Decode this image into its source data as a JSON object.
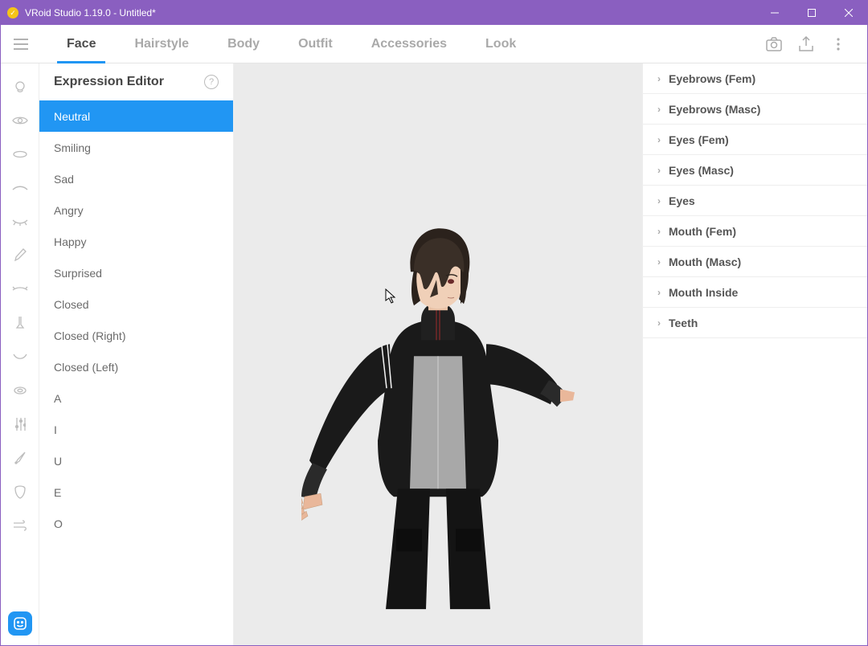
{
  "titlebar": {
    "title": "VRoid Studio 1.19.0 - Untitled*"
  },
  "tabs": {
    "items": [
      {
        "label": "Face",
        "active": true
      },
      {
        "label": "Hairstyle",
        "active": false
      },
      {
        "label": "Body",
        "active": false
      },
      {
        "label": "Outfit",
        "active": false
      },
      {
        "label": "Accessories",
        "active": false
      },
      {
        "label": "Look",
        "active": false
      }
    ]
  },
  "leftpanel": {
    "title": "Expression Editor",
    "items": [
      {
        "label": "Neutral",
        "active": true
      },
      {
        "label": "Smiling"
      },
      {
        "label": "Sad"
      },
      {
        "label": "Angry"
      },
      {
        "label": "Happy"
      },
      {
        "label": "Surprised"
      },
      {
        "label": "Closed"
      },
      {
        "label": "Closed (Right)"
      },
      {
        "label": "Closed (Left)"
      },
      {
        "label": "A"
      },
      {
        "label": "I"
      },
      {
        "label": "U"
      },
      {
        "label": "E"
      },
      {
        "label": "O"
      }
    ]
  },
  "rightpanel": {
    "items": [
      {
        "label": "Eyebrows (Fem)"
      },
      {
        "label": "Eyebrows (Masc)"
      },
      {
        "label": "Eyes (Fem)"
      },
      {
        "label": "Eyes (Masc)"
      },
      {
        "label": "Eyes"
      },
      {
        "label": "Mouth (Fem)"
      },
      {
        "label": "Mouth (Masc)"
      },
      {
        "label": "Mouth Inside"
      },
      {
        "label": "Teeth"
      }
    ]
  },
  "iconrail": {
    "items": [
      {
        "name": "head-icon"
      },
      {
        "name": "eye-icon"
      },
      {
        "name": "lips-icon"
      },
      {
        "name": "eyebrow-icon"
      },
      {
        "name": "eyelash-icon"
      },
      {
        "name": "paintbrush-icon"
      },
      {
        "name": "eyeline-icon"
      },
      {
        "name": "nose-icon"
      },
      {
        "name": "mouthcurve-icon"
      },
      {
        "name": "ear-icon"
      },
      {
        "name": "sliders-icon"
      },
      {
        "name": "outline-icon"
      },
      {
        "name": "faceoutline-icon"
      },
      {
        "name": "wind-icon"
      }
    ]
  }
}
